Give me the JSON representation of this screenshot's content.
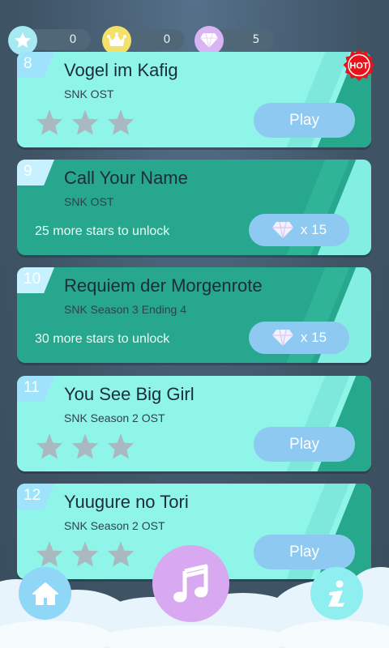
{
  "topbar": {
    "stars": {
      "icon": "star-icon",
      "value": "0",
      "color": "#a6e9f1"
    },
    "crowns": {
      "icon": "crown-icon",
      "value": "0",
      "color": "#f5e06a"
    },
    "gems": {
      "icon": "diamond-icon",
      "value": "5",
      "color": "#d9b4f2"
    }
  },
  "songs": [
    {
      "number": "8",
      "title": "Vogel im Kafig",
      "subtitle": "SNK OST",
      "status": "unlocked",
      "stars_earned": 0,
      "stars_total": 3,
      "action_label": "Play",
      "badge": "HOT"
    },
    {
      "number": "9",
      "title": "Call Your Name",
      "subtitle": "SNK OST",
      "status": "locked",
      "unlock_text": "25 more stars to unlock",
      "cost_label": "x 15"
    },
    {
      "number": "10",
      "title": "Requiem der Morgenrote",
      "subtitle": "SNK Season 3 Ending 4",
      "status": "locked",
      "unlock_text": "30 more stars to unlock",
      "cost_label": "x 15"
    },
    {
      "number": "11",
      "title": "You See Big Girl",
      "subtitle": "SNK Season 2 OST",
      "status": "unlocked",
      "stars_earned": 0,
      "stars_total": 3,
      "action_label": "Play"
    },
    {
      "number": "12",
      "title": "Yuugure no Tori",
      "subtitle": "SNK Season 2 OST",
      "status": "unlocked",
      "stars_earned": 0,
      "stars_total": 3,
      "action_label": "Play"
    }
  ],
  "bottom_nav": {
    "home": {
      "icon": "home-icon"
    },
    "music": {
      "icon": "music-note-icon"
    },
    "info": {
      "icon": "info-icon"
    }
  },
  "colors": {
    "background": "#3f5566",
    "card_unlocked": "#8ff5e9",
    "card_locked": "#27a78d",
    "button": "#8ec9f2",
    "hot_badge": "#e8131a"
  }
}
